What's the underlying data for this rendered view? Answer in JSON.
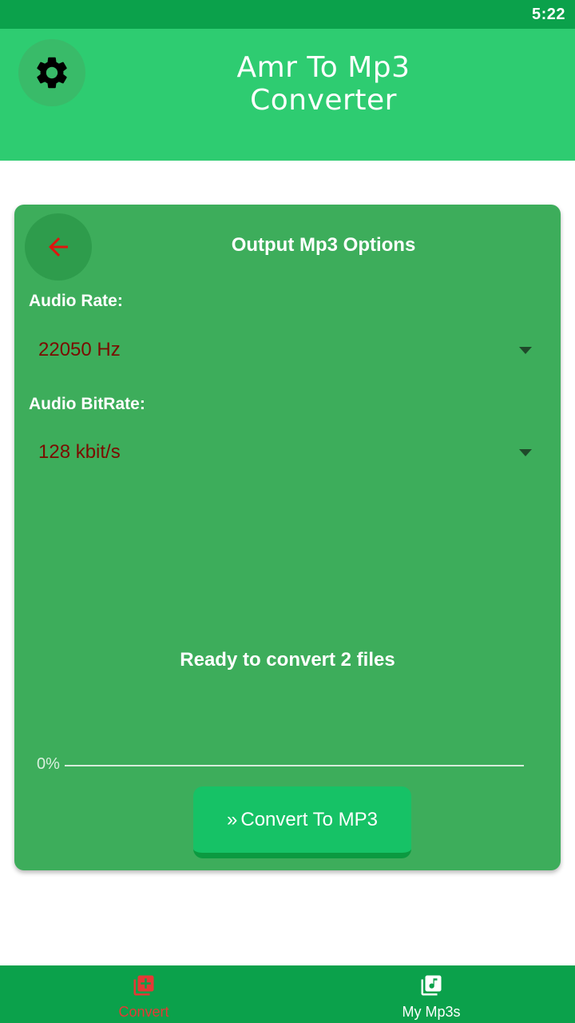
{
  "status_bar": {
    "time": "5:22"
  },
  "header": {
    "title": "Amr To Mp3 Converter",
    "settings_icon": "gear-icon"
  },
  "card": {
    "back_icon": "arrow-left-icon",
    "title": "Output Mp3 Options",
    "audio_rate": {
      "label": "Audio Rate:",
      "value": "22050 Hz"
    },
    "audio_bitrate": {
      "label": "Audio BitRate:",
      "value": "128 kbit/s"
    },
    "status_message": "Ready to convert 2 files",
    "progress": {
      "percent_text": "0%",
      "value": 0
    },
    "convert_button": {
      "label": "Convert To MP3",
      "icon": "double-chevron-right-icon"
    }
  },
  "bottom_nav": {
    "items": [
      {
        "label": "Convert",
        "icon": "add-to-library-icon",
        "active": true
      },
      {
        "label": "My Mp3s",
        "icon": "music-library-icon",
        "active": false
      }
    ]
  },
  "colors": {
    "status_bar": "#0ba14b",
    "header": "#2ecc71",
    "card": "#3dad5b",
    "accent_red": "#e53935",
    "value_text": "#7a0c00",
    "button": "#16c266"
  }
}
